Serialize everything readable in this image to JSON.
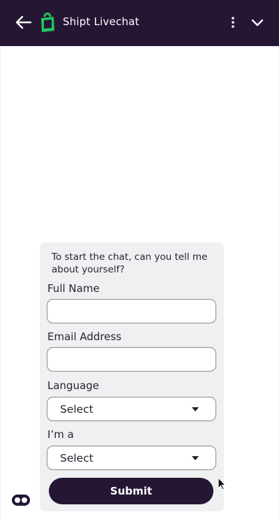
{
  "header": {
    "title": "Shipt Livechat",
    "back_icon": "arrow-left-icon",
    "menu_icon": "more-vertical-icon",
    "minimize_icon": "chevron-down-icon",
    "logo_icon": "shipt-bag-logo"
  },
  "form": {
    "intro": "To start the chat, can you tell me about yourself?",
    "full_name_label": "Full Name",
    "full_name_value": "",
    "email_label": "Email Address",
    "email_value": "",
    "language_label": "Language",
    "language_selected": "Select",
    "role_label": "I’m a",
    "role_selected": "Select",
    "submit_label": "Submit"
  },
  "colors": {
    "header_bg": "#251734",
    "brand_green": "#22c55e",
    "card_bg": "#eff0f2",
    "button_bg": "#251734"
  }
}
